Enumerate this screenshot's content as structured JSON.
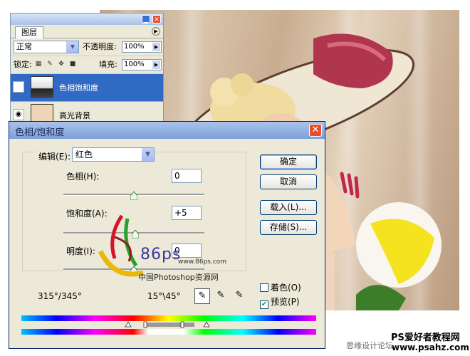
{
  "layers_panel": {
    "tab_label": "图层",
    "blend_mode": "正常",
    "opacity_label": "不透明度:",
    "opacity_value": "100%",
    "lock_label": "锁定:",
    "fill_label": "填充:",
    "fill_value": "100%",
    "layers": [
      {
        "name": "色相饱和度",
        "selected": true
      },
      {
        "name": "高光背景",
        "selected": false
      }
    ]
  },
  "dialog": {
    "title": "色相/饱和度",
    "edit_label": "编辑(E):",
    "edit_value": "红色",
    "hue_label": "色相(H):",
    "hue_value": "0",
    "saturation_label": "饱和度(A):",
    "saturation_value": "+5",
    "lightness_label": "明度(I):",
    "lightness_value": "0",
    "ok_label": "确定",
    "cancel_label": "取消",
    "load_label": "载入(L)...",
    "save_label": "存储(S)...",
    "colorize_label": "着色(O)",
    "colorize_checked": false,
    "preview_label": "预览(P)",
    "preview_checked": true,
    "range_left": "315°/345°",
    "range_right": "15°\\45°",
    "hue_slider_level": 0.5,
    "saturation_slider_level": 0.51,
    "lightness_slider_level": 0.5
  },
  "watermarks": {
    "center_number": "86ps",
    "center_url": "www.86ps.com",
    "center_caption": "中国Photoshop资源网",
    "bottom_right_title": "PS爱好者教程网",
    "bottom_right_url": "www.psahz.com",
    "bottom_forum": "思缘设计论坛"
  },
  "colors": {
    "title_bar": "#7e9fd8",
    "selection": "#316ac5",
    "dialog_bg": "#ece9d8",
    "close_red": "#e44e2a"
  }
}
